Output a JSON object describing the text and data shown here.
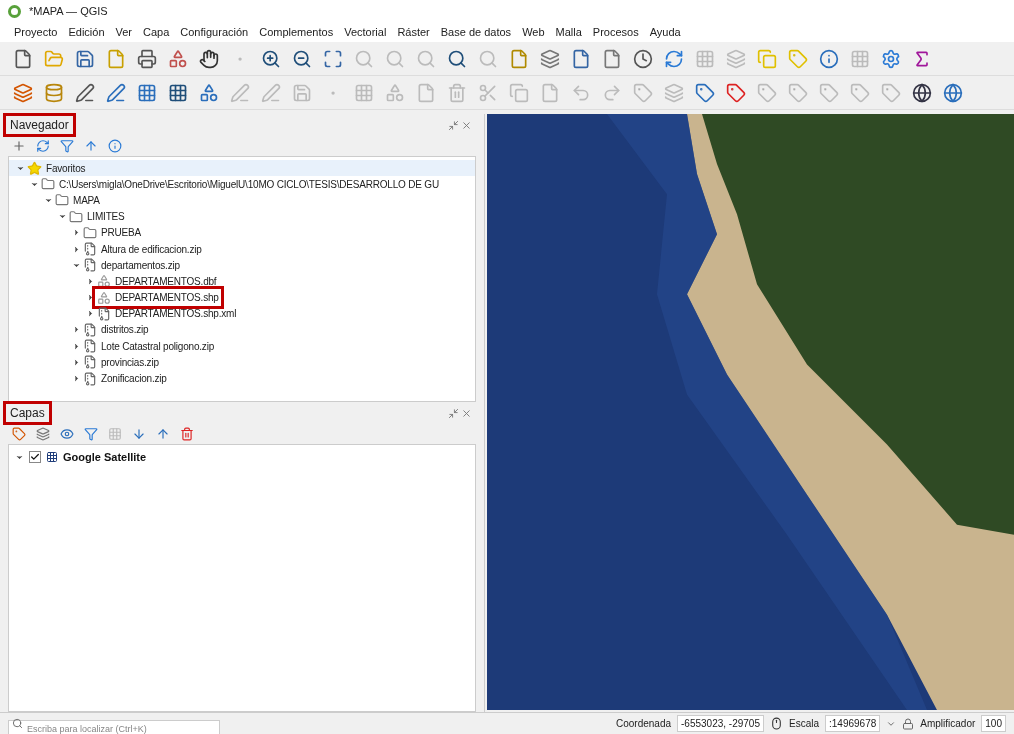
{
  "window": {
    "title": "*MAPA — QGIS"
  },
  "menu": [
    "Proyecto",
    "Edición",
    "Ver",
    "Capa",
    "Configuración",
    "Complementos",
    "Vectorial",
    "Ráster",
    "Base de datos",
    "Web",
    "Malla",
    "Procesos",
    "Ayuda"
  ],
  "browser_panel": {
    "title": "Navegador",
    "highlighted": true,
    "tree": [
      {
        "label": "Favoritos",
        "kind": "star",
        "expanded": true,
        "selected": true,
        "highlighted": false,
        "children": [
          {
            "label": "C:\\Users\\migla\\OneDrive\\Escritorio\\MiguelU\\10MO CICLO\\TESIS\\DESARROLLO DE GU",
            "kind": "folder",
            "expanded": true,
            "selected": false,
            "highlighted": false,
            "children": [
              {
                "label": "MAPA",
                "kind": "folder",
                "expanded": true,
                "selected": false,
                "highlighted": false,
                "children": [
                  {
                    "label": "LIMITES",
                    "kind": "folder",
                    "expanded": true,
                    "selected": false,
                    "highlighted": false,
                    "children": [
                      {
                        "label": "PRUEBA",
                        "kind": "folder",
                        "expanded": false,
                        "selected": false,
                        "highlighted": false
                      },
                      {
                        "label": "Altura de edificacion.zip",
                        "kind": "zip",
                        "expanded": false,
                        "selected": false,
                        "highlighted": false
                      },
                      {
                        "label": "departamentos.zip",
                        "kind": "zip",
                        "expanded": true,
                        "selected": false,
                        "highlighted": false,
                        "children": [
                          {
                            "label": "DEPARTAMENTOS.dbf",
                            "kind": "layer",
                            "expanded": false,
                            "selected": false,
                            "highlighted": false
                          },
                          {
                            "label": "DEPARTAMENTOS.shp",
                            "kind": "layer",
                            "expanded": false,
                            "selected": false,
                            "highlighted": true
                          },
                          {
                            "label": "DEPARTAMENTOS.shp.xml",
                            "kind": "zip",
                            "expanded": false,
                            "selected": false,
                            "highlighted": false
                          }
                        ]
                      },
                      {
                        "label": "distritos.zip",
                        "kind": "zip",
                        "expanded": false,
                        "selected": false,
                        "highlighted": false
                      },
                      {
                        "label": "Lote Catastral poligono.zip",
                        "kind": "zip",
                        "expanded": false,
                        "selected": false,
                        "highlighted": false
                      },
                      {
                        "label": "provincias.zip",
                        "kind": "zip",
                        "expanded": false,
                        "selected": false,
                        "highlighted": false
                      },
                      {
                        "label": "Zonificacion.zip",
                        "kind": "zip",
                        "expanded": false,
                        "selected": false,
                        "highlighted": false
                      }
                    ]
                  }
                ]
              }
            ]
          }
        ]
      }
    ]
  },
  "layers_panel": {
    "title": "Capas",
    "highlighted": true,
    "layers": [
      {
        "label": "Google Satellite",
        "checked": true,
        "expanded": true
      }
    ]
  },
  "status_bar": {
    "search": {
      "placeholder": "Escriba para localizar (Ctrl+K)"
    },
    "coordinate_label": "Coordenada",
    "coordinate": "-6553023, -29705",
    "scale_label": "Escala",
    "scale": ":14969678",
    "magnifier_label": "Amplificador",
    "magnifier": "100"
  }
}
